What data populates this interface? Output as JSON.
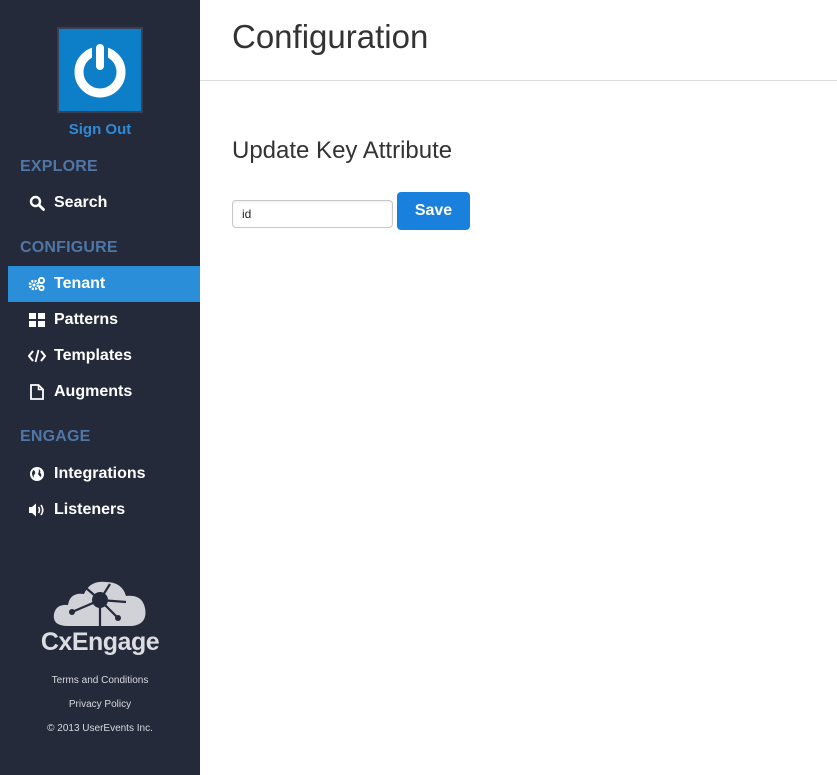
{
  "sidebar": {
    "power_icon": "power-icon",
    "sign_out": "Sign Out",
    "sections": {
      "explore": "EXPLORE",
      "configure": "CONFIGURE",
      "engage": "ENGAGE"
    },
    "items": {
      "search": {
        "label": "Search",
        "icon": "search-icon"
      },
      "tenant": {
        "label": "Tenant",
        "icon": "gears-icon",
        "active": true
      },
      "patterns": {
        "label": "Patterns",
        "icon": "grid-icon"
      },
      "templates": {
        "label": "Templates",
        "icon": "code-icon"
      },
      "augments": {
        "label": "Augments",
        "icon": "file-icon"
      },
      "integrations": {
        "label": "Integrations",
        "icon": "globe-icon"
      },
      "listeners": {
        "label": "Listeners",
        "icon": "speaker-icon"
      }
    },
    "brand": "CxEngage",
    "footer": {
      "terms": "Terms and Conditions",
      "privacy": "Privacy Policy",
      "copyright": "© 2013 UserEvents Inc."
    }
  },
  "main": {
    "title": "Configuration",
    "section_title": "Update Key Attribute",
    "key_attribute_value": "id",
    "save_label": "Save"
  },
  "colors": {
    "sidebar_bg": "#252a3a",
    "active_item": "#2a8fd8",
    "section_head": "#4e77a8",
    "accent": "#1a80dd",
    "sign_out": "#2f8ad8"
  }
}
